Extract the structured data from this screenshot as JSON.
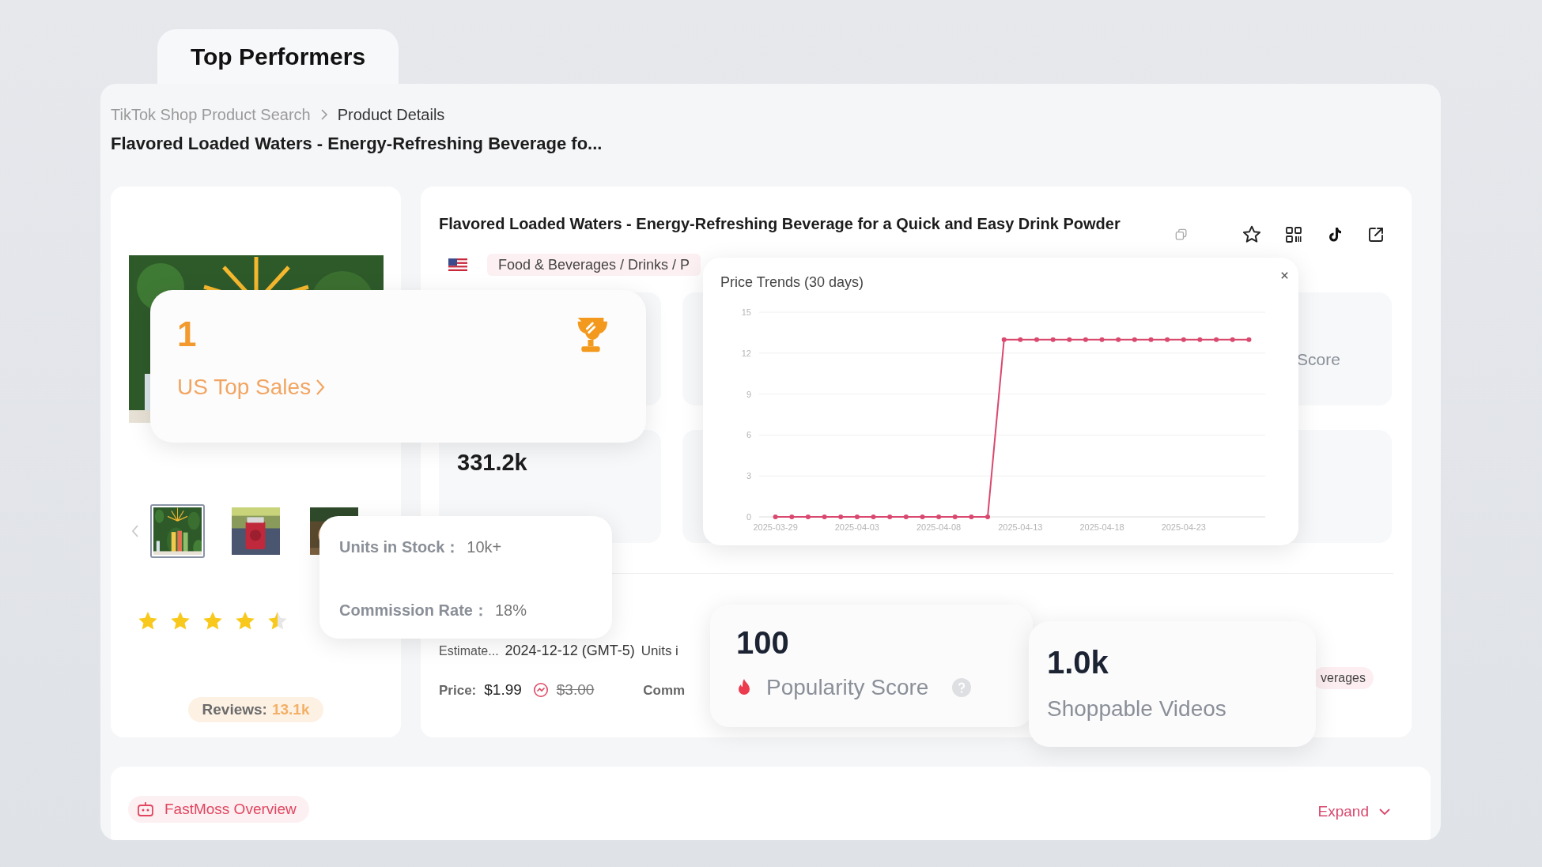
{
  "tab": {
    "label": "Top Performers",
    "selected": true
  },
  "breadcrumb": [
    {
      "label": "TikTok Shop Product Search"
    },
    {
      "label": "Product Details"
    }
  ],
  "page_title": "Flavored Loaded Waters - Energy-Refreshing Beverage fo...",
  "gallery": {
    "thumbnails": [
      {
        "selected": true
      },
      {
        "selected": false
      },
      {
        "selected": false
      }
    ],
    "stars": 4.5,
    "reviews_label": "Reviews:",
    "reviews_count": "13.1k"
  },
  "product": {
    "title": "Flavored Loaded Waters - Energy-Refreshing Beverage for a Quick and Easy Drink Powder",
    "category": "Food & Beverages / Drinks / P",
    "score_label": "Score",
    "sales_value": "331.2k",
    "estimate_label": "Estimate...",
    "date": "2024-12-12 (GMT-5)",
    "units_cut": "Units i",
    "price_label": "Price:",
    "price": "$1.99",
    "original_price": "$3.00",
    "commission_cut": "Comm",
    "tag_cut": "verages"
  },
  "overview": {
    "label": "FastMoss Overview",
    "expand": "Expand"
  },
  "top_sales": {
    "rank": "1",
    "label": "US Top Sales"
  },
  "stock_tooltip": [
    {
      "label": "Units in Stock：",
      "value": "10k+"
    },
    {
      "label": "Commission Rate：",
      "value": "18%"
    }
  ],
  "price_trends": {
    "title": "Price Trends (30 days)",
    "chart_data": {
      "type": "line",
      "x": [
        "2025-03-29",
        "2025-03-30",
        "2025-03-31",
        "2025-04-01",
        "2025-04-02",
        "2025-04-03",
        "2025-04-04",
        "2025-04-05",
        "2025-04-06",
        "2025-04-07",
        "2025-04-08",
        "2025-04-09",
        "2025-04-10",
        "2025-04-11",
        "2025-04-12",
        "2025-04-13",
        "2025-04-14",
        "2025-04-15",
        "2025-04-16",
        "2025-04-17",
        "2025-04-18",
        "2025-04-19",
        "2025-04-20",
        "2025-04-21",
        "2025-04-22",
        "2025-04-23",
        "2025-04-24",
        "2025-04-25",
        "2025-04-26",
        "2025-04-27"
      ],
      "series": [
        {
          "color": "#d9486e",
          "values": [
            0,
            0,
            0,
            0,
            0,
            0,
            0,
            0,
            0,
            0,
            0,
            0,
            0,
            0,
            12.99,
            12.99,
            12.99,
            12.99,
            12.99,
            12.99,
            12.99,
            12.99,
            12.99,
            12.99,
            12.99,
            12.99,
            12.99,
            12.99,
            12.99,
            12.99
          ]
        }
      ],
      "xlim": [
        "2025-03-28",
        "2025-04-28"
      ],
      "grid": true,
      "marker": true,
      "ylim": [
        0,
        15
      ],
      "yticks": [
        0,
        3,
        6,
        9,
        12,
        15
      ],
      "xticks": [
        "2025-03-29",
        "2025-04-03",
        "2025-04-08",
        "2025-04-13",
        "2025-04-18",
        "2025-04-23"
      ]
    }
  },
  "popularity": {
    "value": "100",
    "label": "Popularity Score"
  },
  "shoppable": {
    "value": "1.0k",
    "label": "Shoppable Videos"
  }
}
